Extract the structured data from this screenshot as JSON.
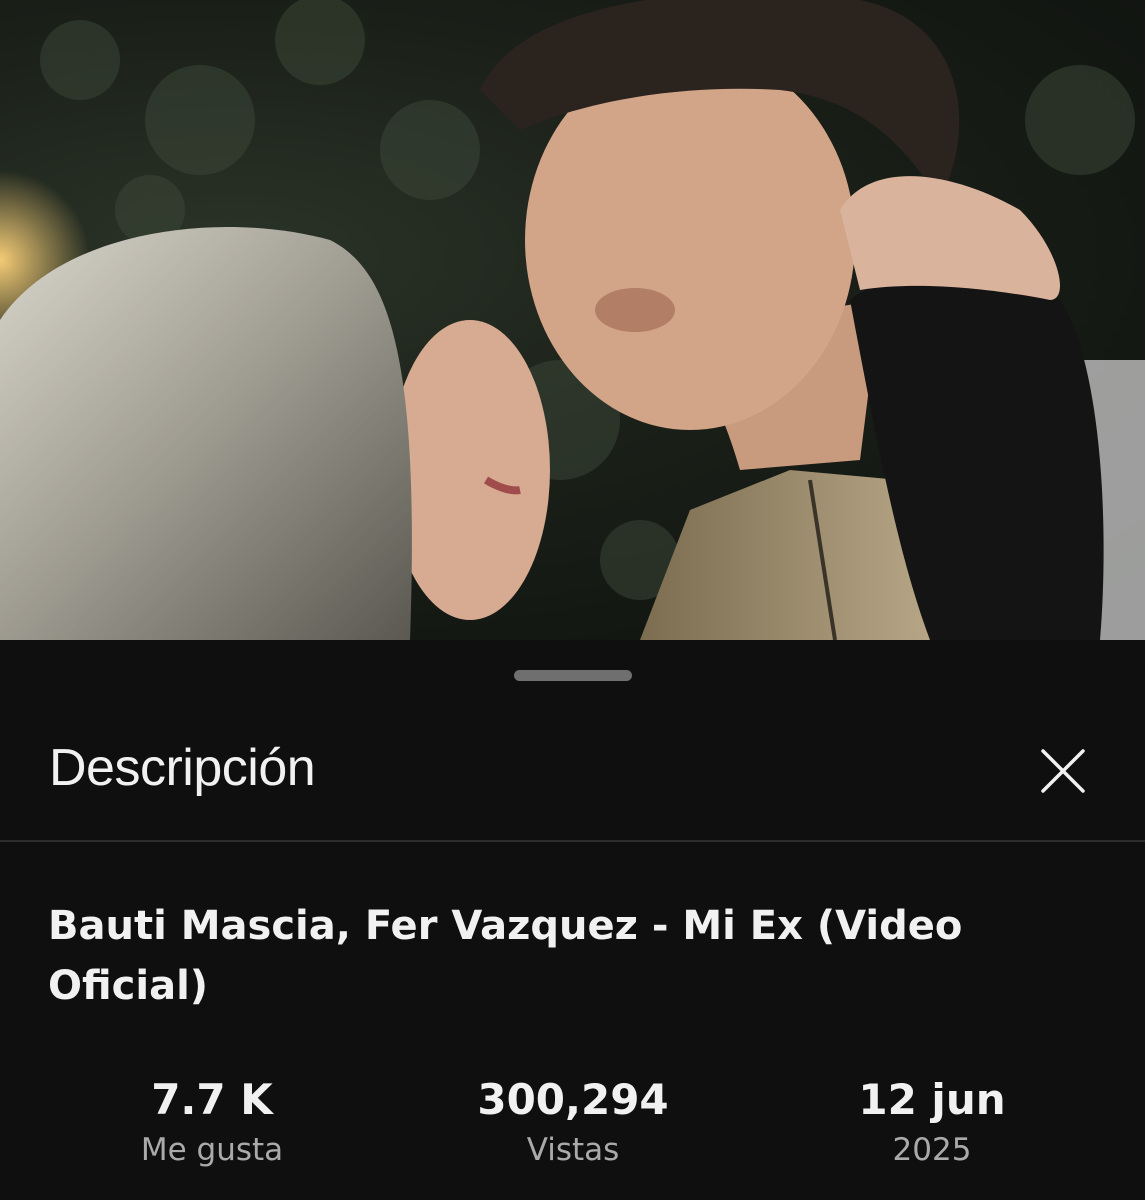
{
  "video": {
    "thumbnail_icon": "music-video-frame",
    "progress_fraction": 1.0
  },
  "sheet": {
    "title": "Descripción",
    "close_icon": "close-icon"
  },
  "details": {
    "video_title": "Bauti Mascia, Fer Vazquez - Mi Ex (Video Oficial)",
    "stats": [
      {
        "value": "7.7 K",
        "label": "Me gusta"
      },
      {
        "value": "300,294",
        "label": "Vistas"
      },
      {
        "value": "12 jun",
        "label": "2025"
      }
    ]
  },
  "colors": {
    "background": "#0f0f0f",
    "text_primary": "#f1f1f1",
    "text_secondary": "#aaaaaa",
    "divider": "#2c2c2c"
  }
}
